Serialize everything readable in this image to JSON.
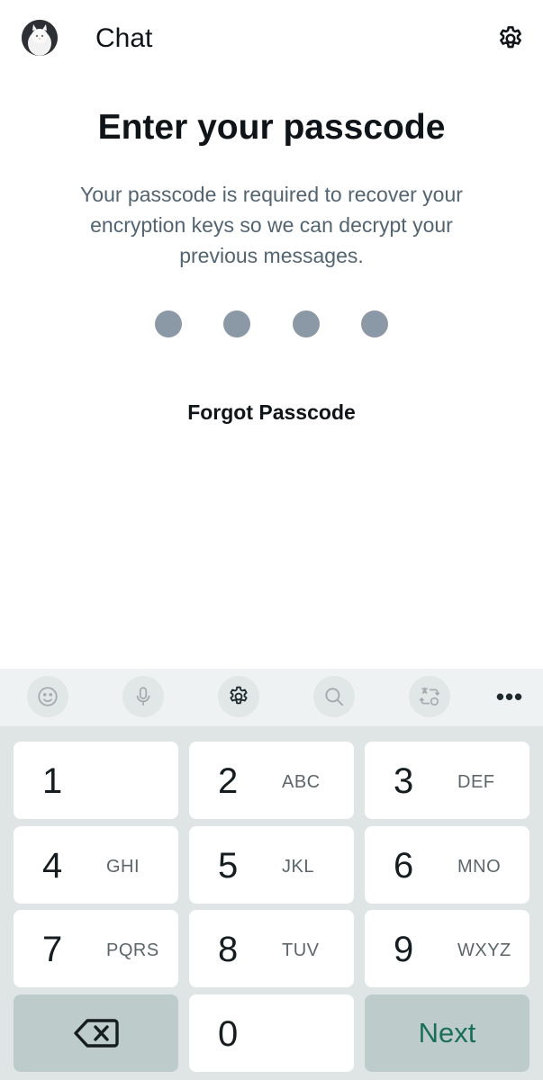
{
  "header": {
    "title": "Chat"
  },
  "main": {
    "title": "Enter your passcode",
    "description": "Your passcode is required to recover your encryption keys so we can decrypt your previous messages.",
    "passcode_length": 4,
    "forgot_label": "Forgot Passcode"
  },
  "keyboard": {
    "toolbar_icons": [
      "emoji-icon",
      "microphone-icon",
      "gear-icon",
      "search-icon",
      "translate-icon",
      "more-icon"
    ],
    "more_label": "•••",
    "keys": [
      {
        "num": "1",
        "letters": ""
      },
      {
        "num": "2",
        "letters": "ABC"
      },
      {
        "num": "3",
        "letters": "DEF"
      },
      {
        "num": "4",
        "letters": "GHI"
      },
      {
        "num": "5",
        "letters": "JKL"
      },
      {
        "num": "6",
        "letters": "MNO"
      },
      {
        "num": "7",
        "letters": "PQRS"
      },
      {
        "num": "8",
        "letters": "TUV"
      },
      {
        "num": "9",
        "letters": "WXYZ"
      }
    ],
    "zero": "0",
    "next_label": "Next"
  },
  "colors": {
    "dot": "#8b98a5",
    "next_text": "#1c6e5c",
    "description_text": "#536471"
  }
}
